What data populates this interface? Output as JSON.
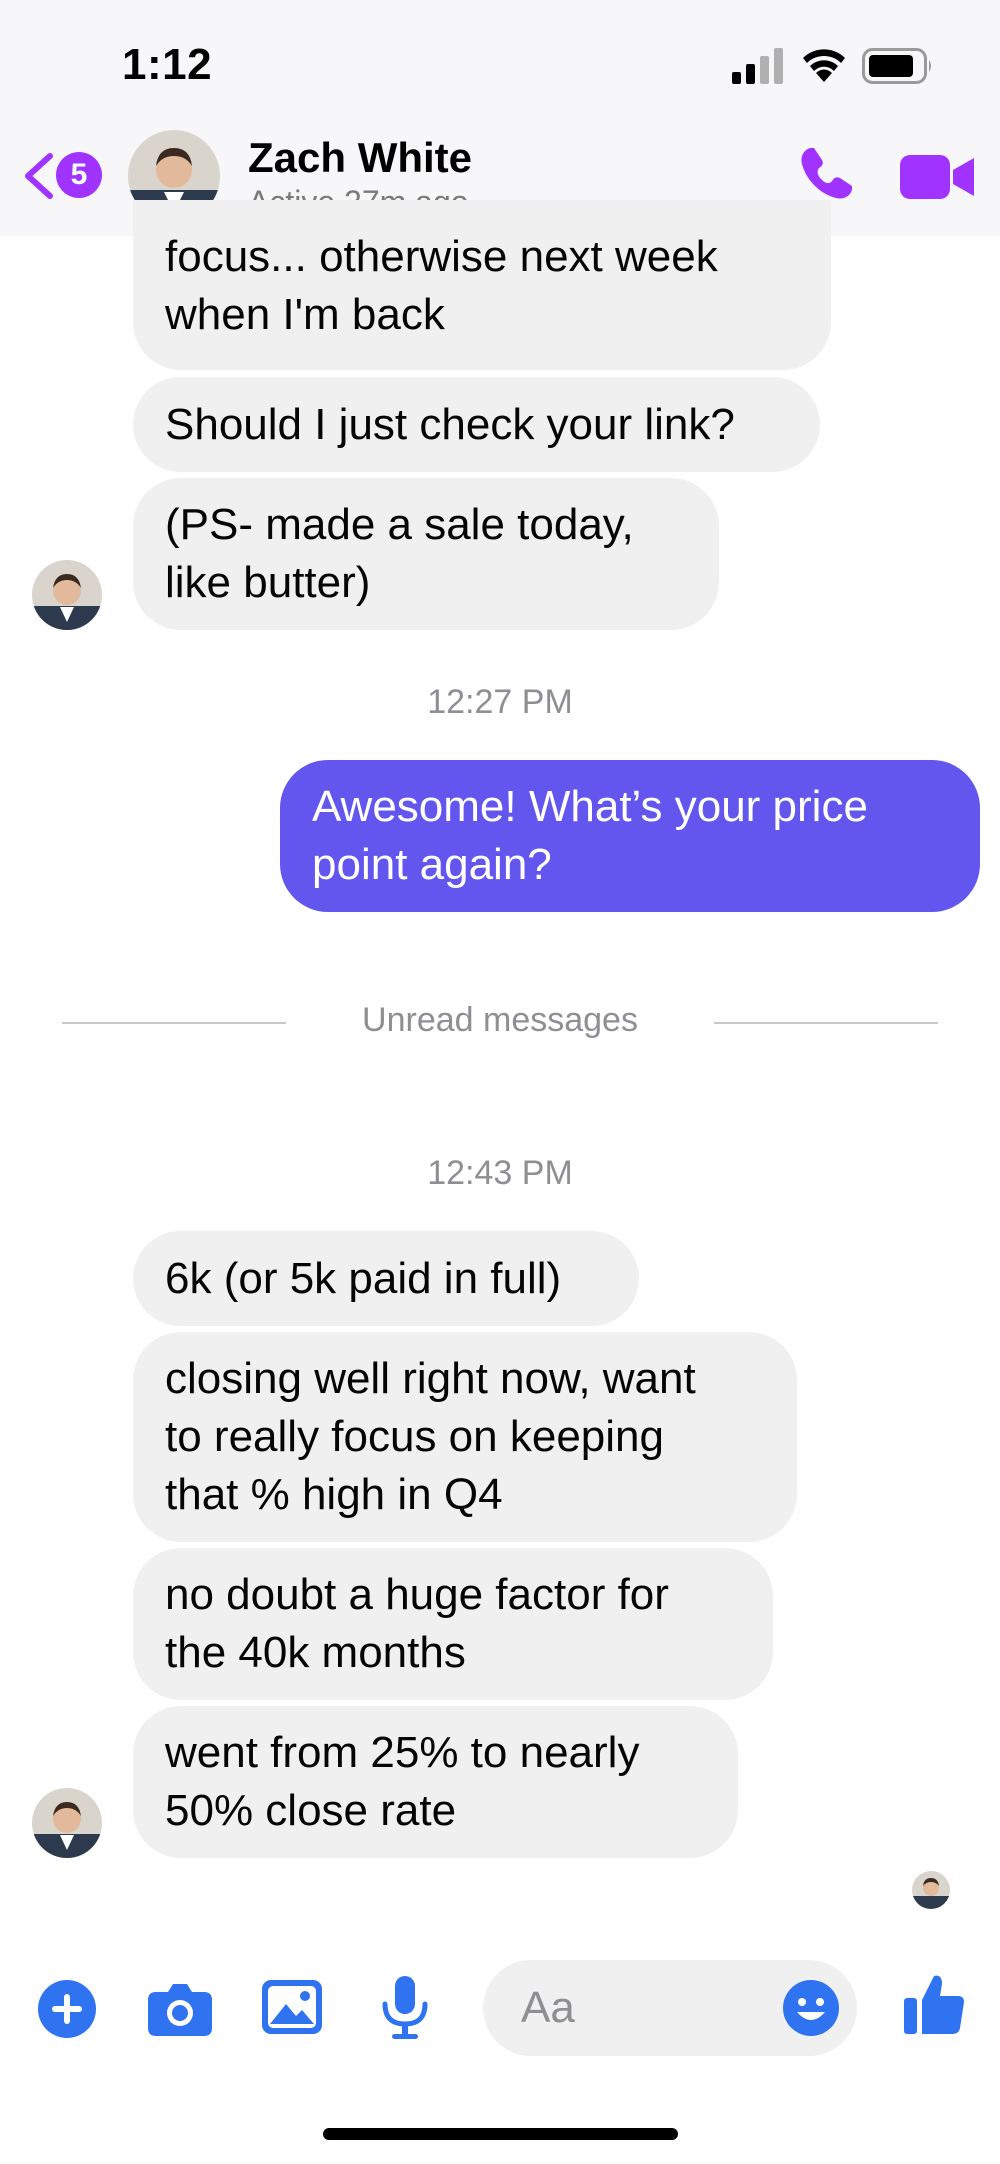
{
  "status_bar": {
    "time": "1:12"
  },
  "header": {
    "unread_count": "5",
    "contact_name": "Zach White",
    "contact_status": "Active 27m ago",
    "accent_color": "#a033ff"
  },
  "messages": [
    {
      "direction": "in",
      "text": "focus... otherwise next week\nwhen I'm back"
    },
    {
      "direction": "in",
      "text": "Should I just check your link?"
    },
    {
      "direction": "in",
      "text": "(PS- made a sale today,\nlike butter)"
    },
    {
      "direction": "out",
      "text": "Awesome!  What’s your price\npoint again?"
    },
    {
      "direction": "in",
      "text": "6k (or 5k paid in full)"
    },
    {
      "direction": "in",
      "text": "closing well right now, want\nto really focus on keeping\nthat % high in Q4"
    },
    {
      "direction": "in",
      "text": "no doubt a huge factor for\nthe 40k months"
    },
    {
      "direction": "in",
      "text": "went from 25% to nearly\n50% close rate"
    }
  ],
  "timestamps": [
    "12:27 PM",
    "12:43 PM"
  ],
  "unread_divider": "Unread messages",
  "composer": {
    "placeholder": "Aa",
    "icons": [
      "plus-icon",
      "camera-icon",
      "gallery-icon",
      "microphone-icon",
      "emoji-icon",
      "thumbs-up-icon"
    ],
    "icon_color": "#2f73f0"
  },
  "colors": {
    "outgoing_bubble": "#6356ef",
    "incoming_bubble": "#f0f0f0"
  }
}
